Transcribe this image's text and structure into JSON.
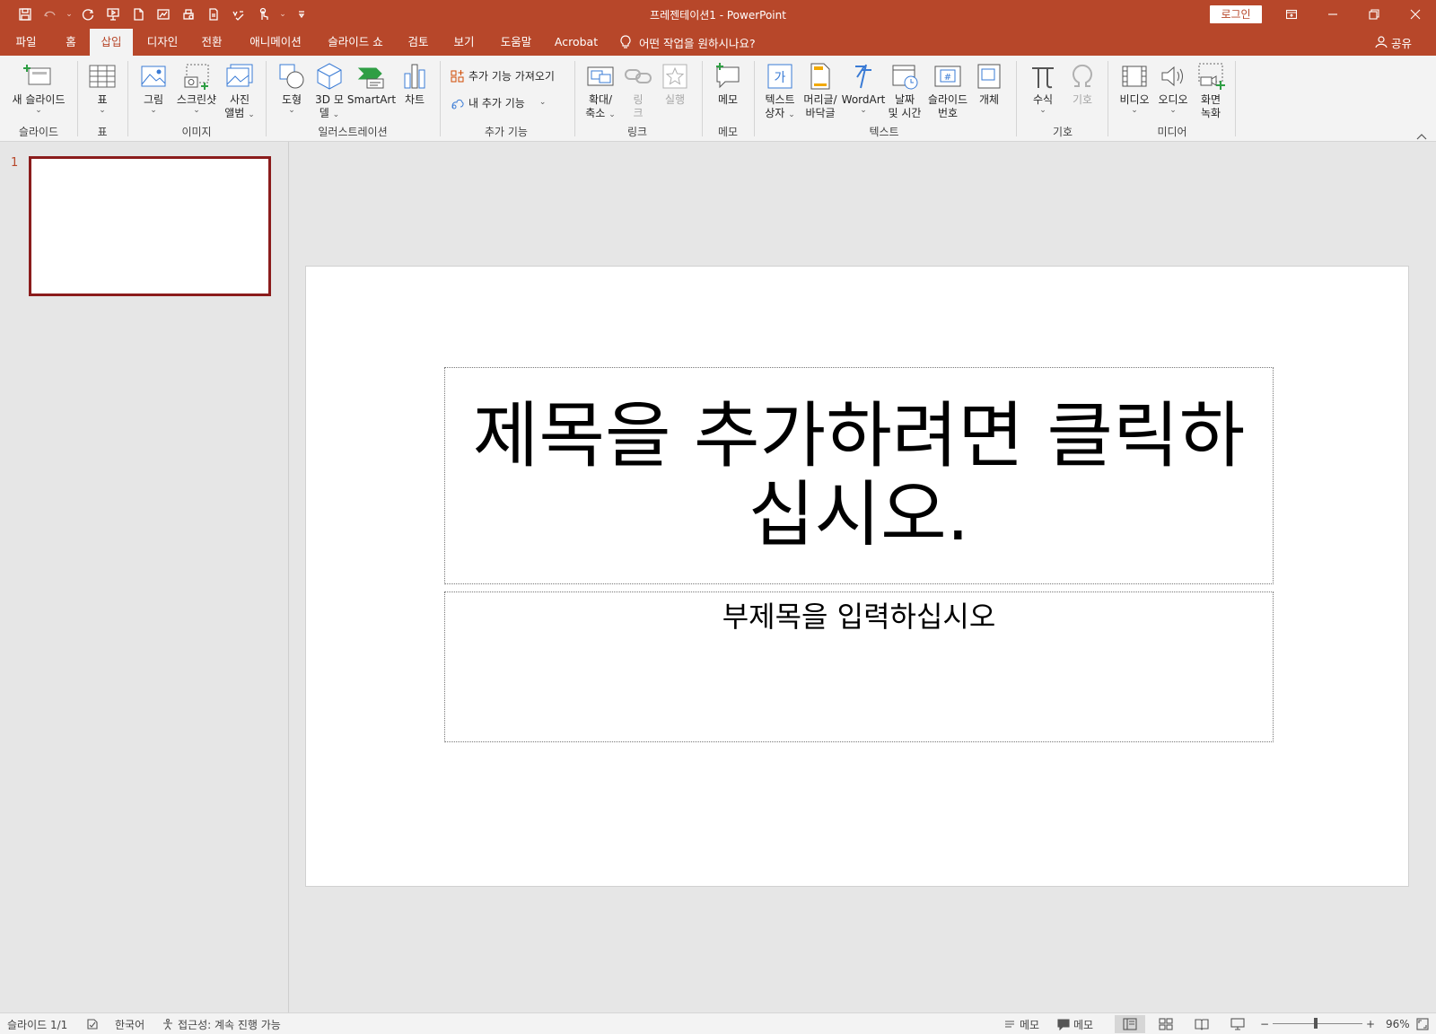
{
  "window": {
    "title": "프레젠테이션1  -  PowerPoint",
    "login_label": "로그인"
  },
  "colors": {
    "accent": "#b7472a",
    "slide_border_selected": "#8b1c1c"
  },
  "quick_access": {
    "icons": [
      "save-icon",
      "undo-icon",
      "redo-icon",
      "start-slideshow-icon",
      "new-document-icon",
      "chart-icon",
      "print-preview-icon",
      "print-icon",
      "spelling-icon",
      "touch-mode-icon",
      "customize-qat-icon"
    ]
  },
  "tabs": [
    {
      "label": "파일"
    },
    {
      "label": "홈"
    },
    {
      "label": "삽입"
    },
    {
      "label": "디자인"
    },
    {
      "label": "전환"
    },
    {
      "label": "애니메이션"
    },
    {
      "label": "슬라이드 쇼"
    },
    {
      "label": "검토"
    },
    {
      "label": "보기"
    },
    {
      "label": "도움말"
    },
    {
      "label": "Acrobat"
    }
  ],
  "active_tab": "삽입",
  "tell_me": "어떤 작업을 원하시나요?",
  "share_label": "공유",
  "ribbon": {
    "groups": {
      "slides": "슬라이드",
      "tables": "표",
      "images": "이미지",
      "illustrations": "일러스트레이션",
      "addins": "추가 기능",
      "links": "링크",
      "comments": "메모",
      "text": "텍스트",
      "symbols": "기호",
      "media": "미디어"
    },
    "buttons": {
      "new_slide": [
        "새 슬라이드"
      ],
      "table": [
        "표"
      ],
      "picture": [
        "그림"
      ],
      "screenshot": [
        "스크린샷"
      ],
      "photo_album": [
        "사진",
        "앨범"
      ],
      "shapes": [
        "도형"
      ],
      "model_3d": [
        "3D 모",
        "델"
      ],
      "smartart": [
        "SmartArt"
      ],
      "chart": [
        "차트"
      ],
      "get_addins": "추가 기능 가져오기",
      "my_addins": "내 추가 기능",
      "zoom": [
        "확대/",
        "축소"
      ],
      "link": [
        "링",
        "크"
      ],
      "action": [
        "실행"
      ],
      "comment": [
        "메모"
      ],
      "text_box": [
        "텍스트",
        "상자"
      ],
      "header_footer": [
        "머리글/",
        "바닥글"
      ],
      "wordart": [
        "WordArt"
      ],
      "date_time": [
        "날짜",
        "및 시간"
      ],
      "slide_number": [
        "슬라이드",
        "번호"
      ],
      "object": [
        "개체"
      ],
      "equation": [
        "수식"
      ],
      "symbol": [
        "기호"
      ],
      "video": [
        "비디오"
      ],
      "audio": [
        "오디오"
      ],
      "screen_recording": [
        "화면",
        "녹화"
      ]
    }
  },
  "thumbnails": [
    {
      "number": "1"
    }
  ],
  "slide": {
    "title_placeholder": "제목을 추가하려면 클릭하십시오.",
    "subtitle_placeholder": "부제목을 입력하십시오"
  },
  "status_bar": {
    "slide_counter": "슬라이드 1/1",
    "language": "한국어",
    "accessibility": "접근성: 계속 진행 가능",
    "notes_label": "메모",
    "comments_label": "메모",
    "zoom_minus": "−",
    "zoom_plus": "+",
    "zoom_level": "96%",
    "zoom_fraction": 0.48
  }
}
